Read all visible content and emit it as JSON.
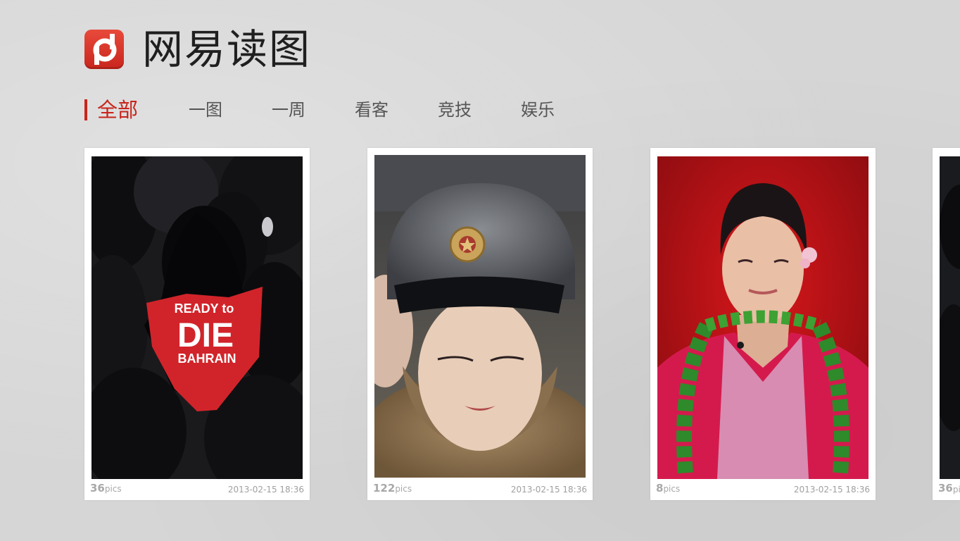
{
  "app": {
    "title": "网易读图",
    "logo_icon": "netease-pic-logo-icon",
    "brand_color": "#c8241b"
  },
  "tabs": [
    {
      "label": "全部",
      "active": true
    },
    {
      "label": "一图",
      "active": false
    },
    {
      "label": "一周",
      "active": false
    },
    {
      "label": "看客",
      "active": false
    },
    {
      "label": "竞技",
      "active": false
    },
    {
      "label": "娱乐",
      "active": false
    }
  ],
  "gallery": [
    {
      "count": "36",
      "unit": "pics",
      "date": "2013-02-15 18:36",
      "shirt_line1": "READY to",
      "shirt_line2": "DIE",
      "shirt_line3": "BAHRAIN"
    },
    {
      "count": "122",
      "unit": "pics",
      "date": "2013-02-15 18:36"
    },
    {
      "count": "8",
      "unit": "pics",
      "date": "2013-02-15 18:36"
    },
    {
      "count": "36",
      "unit": "pics"
    }
  ]
}
